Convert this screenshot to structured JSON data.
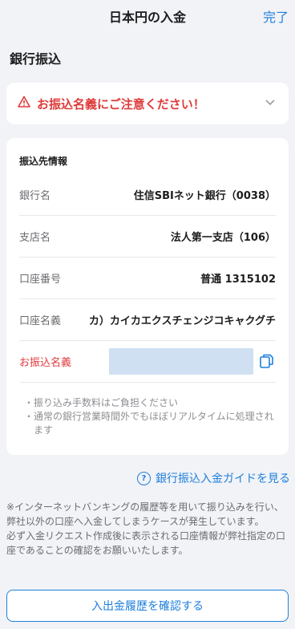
{
  "header": {
    "title": "日本円の入金",
    "done_label": "完了"
  },
  "section_title": "銀行振込",
  "warning": {
    "text": "お振込名義にご注意ください！",
    "icon": "warning-icon",
    "color": "#e03a3a"
  },
  "card": {
    "title": "振込先情報",
    "rows": [
      {
        "label": "銀行名",
        "value": "住信SBIネット銀行（0038）"
      },
      {
        "label": "支店名",
        "value": "法人第一支店（106）"
      },
      {
        "label": "口座番号",
        "value": "普通 1315102"
      },
      {
        "label": "口座名義",
        "value": "カ）カイカエクスチェンジコキャクグチ"
      }
    ],
    "transfer_name_label": "お振込名義",
    "notes": [
      "振り込み手数料はご負担ください",
      "通常の銀行営業時間外でもほぼリアルタイムに処理されます"
    ]
  },
  "guide_link": "銀行振込入金ガイドを見る",
  "disclaimer": [
    "※インターネットバンキングの履歴等を用いて振り込みを行い、弊社以外の口座へ入金してしまうケースが発生しています。",
    "必ず入金リクエスト作成後に表示される口座情報が弊社指定の口座であることの確認をお願いいたします。"
  ],
  "history_button": "入出金履歴を確認する",
  "colors": {
    "accent": "#1e7fdc",
    "danger": "#e03a3a",
    "background": "#f2f3f7"
  }
}
